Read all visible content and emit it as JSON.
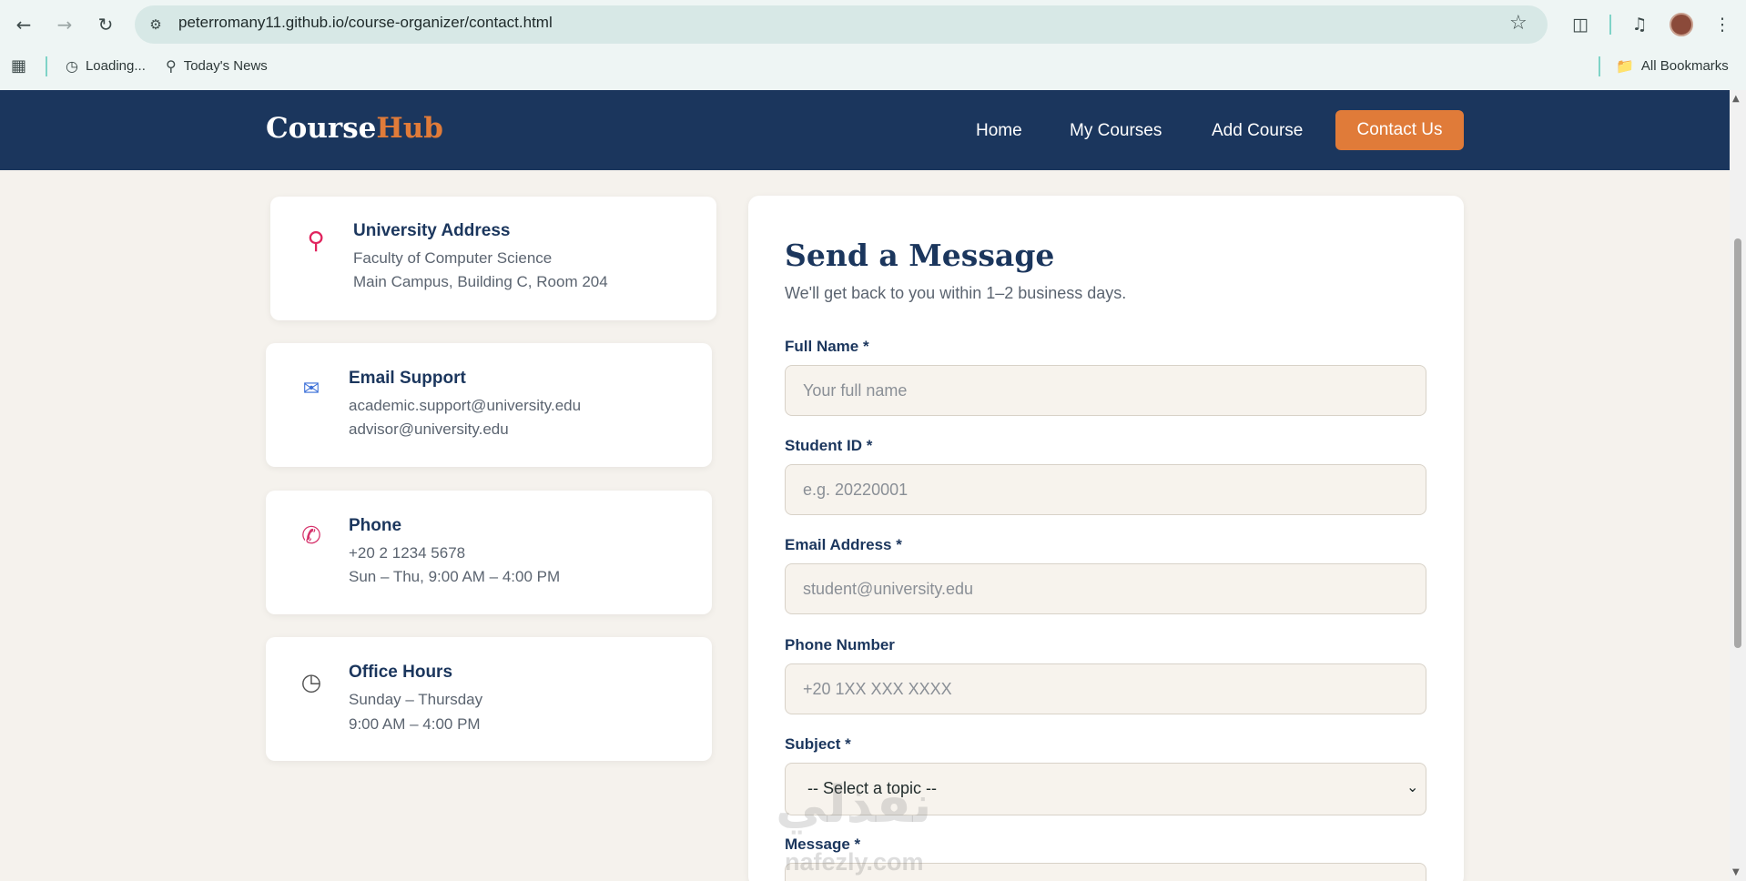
{
  "browser": {
    "url": "peterromany11.github.io/course-organizer/contact.html",
    "bookmarks": [
      {
        "label": "Loading...",
        "icon": "history-icon"
      },
      {
        "label": "Today's News",
        "icon": "search-icon"
      }
    ],
    "all_bookmarks_label": "All Bookmarks"
  },
  "site": {
    "logo_primary": "Course",
    "logo_accent": "Hub",
    "accent_color": "#e07b39",
    "navy_color": "#1b365d",
    "nav": [
      "Home",
      "My Courses",
      "Add Course"
    ],
    "nav_active": "Contact Us"
  },
  "info_cards": [
    {
      "title": "University Address",
      "lines": [
        "Faculty of Computer Science",
        "Main Campus, Building C, Room 204"
      ],
      "icon": "pin-icon"
    },
    {
      "title": "Email Support",
      "lines": [
        "academic.support@university.edu",
        "advisor@university.edu"
      ],
      "icon": "email-icon"
    },
    {
      "title": "Phone",
      "lines": [
        "+20 2 1234 5678",
        "Sun – Thu, 9:00 AM – 4:00 PM"
      ],
      "icon": "phone-icon"
    },
    {
      "title": "Office Hours",
      "lines": [
        "Sunday – Thursday",
        "9:00 AM – 4:00 PM"
      ],
      "icon": "clock-icon"
    }
  ],
  "form": {
    "title": "Send a Message",
    "subtitle": "We'll get back to you within 1–2 business days.",
    "full_name": {
      "label": "Full Name *",
      "placeholder": "Your full name"
    },
    "student_id": {
      "label": "Student ID *",
      "placeholder": "e.g. 20220001"
    },
    "email": {
      "label": "Email Address *",
      "placeholder": "student@university.edu"
    },
    "phone": {
      "label": "Phone Number",
      "placeholder": "+20 1XX XXX XXXX"
    },
    "subject": {
      "label": "Subject *",
      "selected": "-- Select a topic --"
    },
    "message": {
      "label": "Message *"
    }
  },
  "watermark": {
    "text": "نفذلي",
    "sub": "nafezly.com"
  }
}
